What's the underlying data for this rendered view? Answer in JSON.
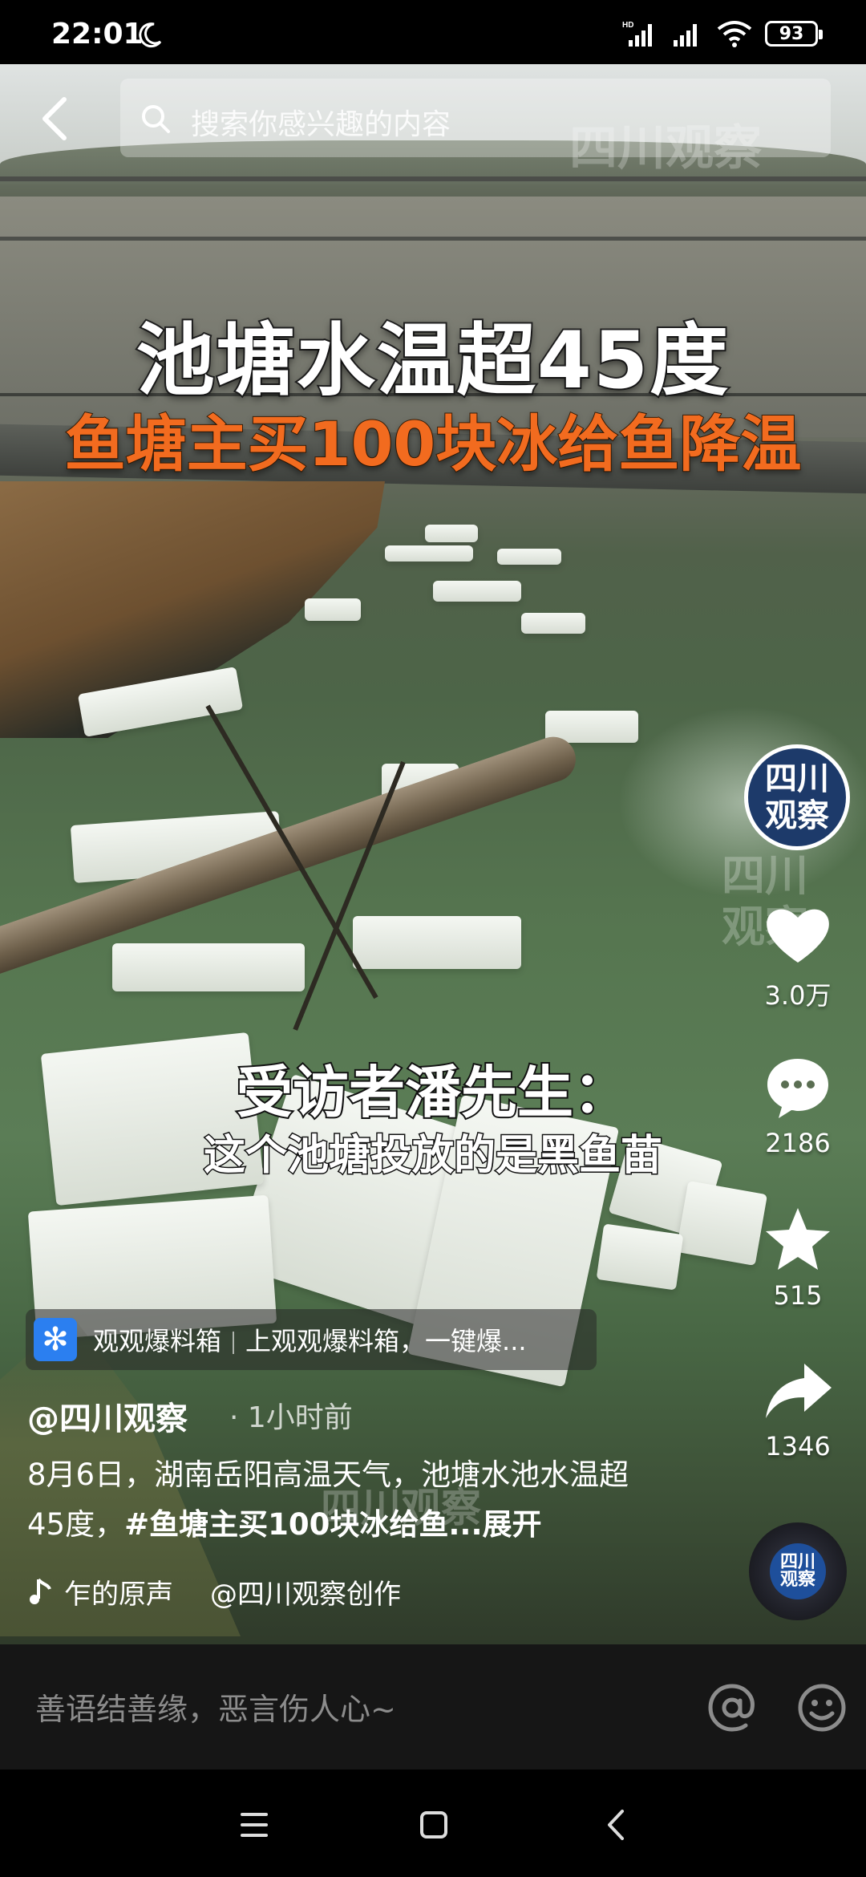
{
  "status_bar": {
    "time": "22:01",
    "network_label": "HD",
    "battery": "93"
  },
  "search": {
    "placeholder": "搜索你感兴趣的内容"
  },
  "video": {
    "headline": "池塘水温超45度",
    "subheadline": "鱼塘主买100块冰给鱼降温",
    "caption_speaker": "受访者潘先生：",
    "caption_line": "这个池塘投放的是黑鱼苗",
    "watermark": "四川观察"
  },
  "account": {
    "avatar_line1": "四川",
    "avatar_line2": "观察"
  },
  "actions": {
    "likes": "3.0万",
    "comments": "2186",
    "favorites": "515",
    "shares": "1346"
  },
  "promo": {
    "icon_glyph": "✻",
    "title": "观观爆料箱",
    "text": "上观观爆料箱，一键爆..."
  },
  "post": {
    "author": "@四川观察",
    "time_ago": "· 1小时前",
    "desc_plain": "8月6日，湖南岳阳高温天气，池塘水池水温超45度，",
    "desc_tag": "#鱼塘主买100块冰给鱼...",
    "expand": "展开",
    "music_title": "乍的原声",
    "music_credit": "@四川观察创作",
    "disc_label": "四川观察"
  },
  "comment_bar": {
    "placeholder": "善语结善缘，恶言伤人心~"
  },
  "colors": {
    "headline_orange": "#f26b1f",
    "avatar_blue": "#1d3a6a",
    "promo_blue": "#2b7ff0"
  }
}
